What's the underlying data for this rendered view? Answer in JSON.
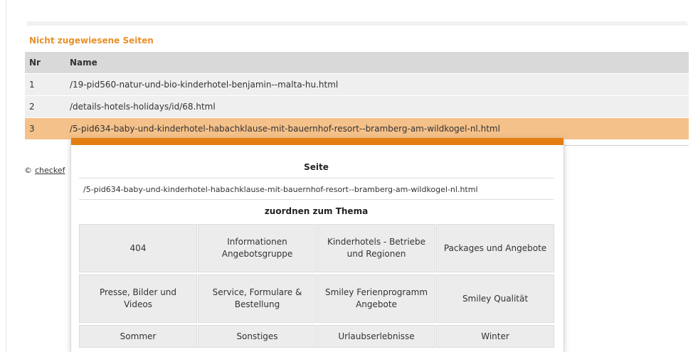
{
  "section_title": "Nicht zugewiesene Seiten",
  "table": {
    "headers": {
      "nr": "Nr",
      "name": "Name"
    },
    "rows": [
      {
        "nr": "1",
        "name": "/19-pid560-natur-und-bio-kinderhotel-benjamin--malta-hu.html"
      },
      {
        "nr": "2",
        "name": "/details-hotels-holidays/id/68.html"
      },
      {
        "nr": "3",
        "name": "/5-pid634-baby-und-kinderhotel-habachklause-mit-bauernhof-resort--bramberg-am-wildkogel-nl.html"
      }
    ],
    "selected_row": 3
  },
  "footer": {
    "copyright": "©",
    "link_text": "checkef"
  },
  "popup": {
    "page_heading": "Seite",
    "page_url": "/5-pid634-baby-und-kinderhotel-habachklause-mit-bauernhof-resort--bramberg-am-wildkogel-nl.html",
    "topic_heading": "zuordnen zum Thema",
    "topics": [
      "404",
      "Informationen Angebotsgruppe",
      "Kinderhotels - Betriebe und Regionen",
      "Packages und Angebote",
      "Presse, Bilder und Videos",
      "Service, Formulare & Bestellung",
      "Smiley Ferienprogramm Angebote",
      "Smiley Qualität",
      "Sommer",
      "Sonstiges",
      "Urlaubserlebnisse",
      "Winter"
    ]
  },
  "colors": {
    "accent_orange": "#e37d12",
    "title_orange": "#e8902a",
    "selected_row": "#f5c18a",
    "header_gray": "#d9d9d9",
    "row_gray": "#efefef"
  }
}
